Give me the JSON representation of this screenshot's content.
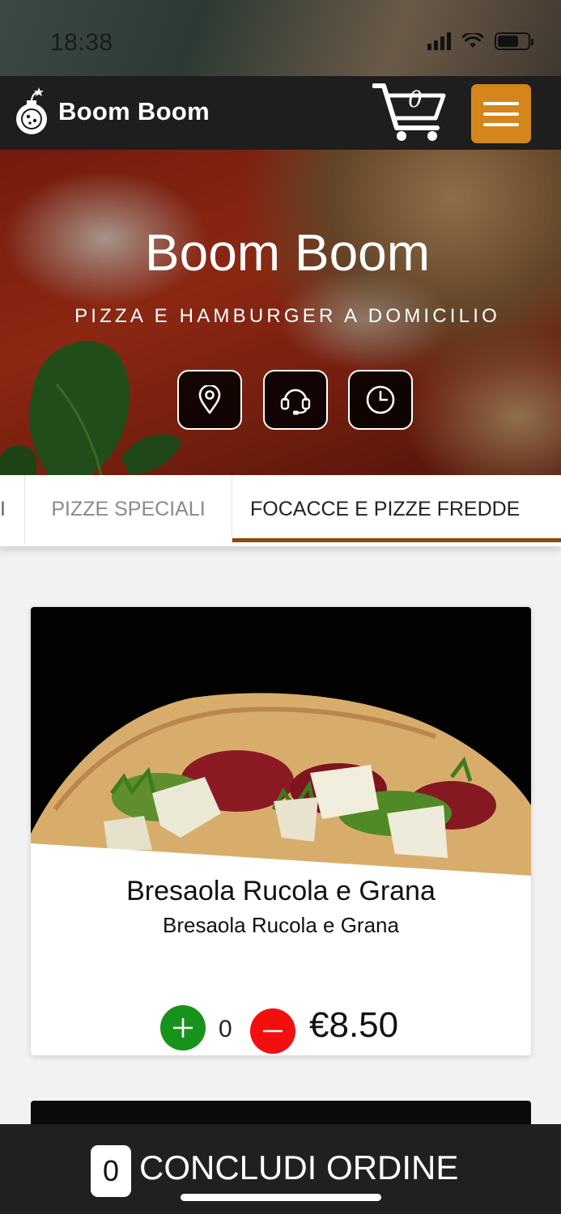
{
  "status_bar": {
    "time": "18:38"
  },
  "header": {
    "brand": "Boom Boom",
    "cart_count": "0",
    "icons": [
      "bomb-pizza-logo-icon",
      "cart-icon",
      "hamburger-menu-icon"
    ],
    "accent_color": "#d4861c"
  },
  "hero": {
    "title": "Boom Boom",
    "subtitle": "PIZZA E HAMBURGER A DOMICILIO",
    "buttons": [
      "location-pin-icon",
      "headset-icon",
      "clock-icon"
    ]
  },
  "tabs": [
    {
      "label": "I",
      "active": false
    },
    {
      "label": "PIZZE SPECIALI",
      "active": false
    },
    {
      "label": "FOCACCE E PIZZE FREDDE",
      "active": true
    }
  ],
  "product": {
    "name": "Bresaola Rucola e Grana",
    "description": "Bresaola Rucola e Grana",
    "quantity": "0",
    "price": "€8.50",
    "plus_color": "#17921a",
    "minus_color": "#f30f0f"
  },
  "order_bar": {
    "count": "0",
    "label": "CONCLUDI ORDINE"
  }
}
